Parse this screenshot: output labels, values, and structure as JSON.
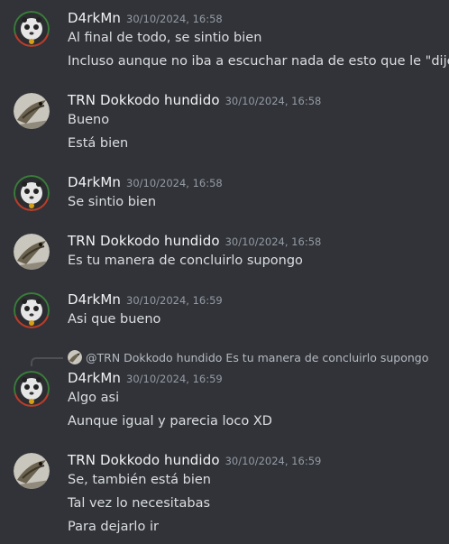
{
  "users": {
    "d4rk": {
      "name": "D4rkMn",
      "avatar_icon": "panda-avatar-icon"
    },
    "trn": {
      "name": "TRN Dokkodo hundido",
      "avatar_icon": "bird-avatar-icon"
    }
  },
  "messages": [
    {
      "user": "D4rkMn",
      "time": "30/10/2024, 16:58",
      "lines": [
        "Al final de todo, se sintio bien",
        "Incluso aunque no iba a escuchar nada de esto que le \"dije\""
      ]
    },
    {
      "user": "TRN Dokkodo hundido",
      "time": "30/10/2024, 16:58",
      "lines": [
        "Bueno",
        "Está bien"
      ]
    },
    {
      "user": "D4rkMn",
      "time": "30/10/2024, 16:58",
      "lines": [
        "Se sintio bien"
      ]
    },
    {
      "user": "TRN Dokkodo hundido",
      "time": "30/10/2024, 16:58",
      "lines": [
        "Es tu manera de concluirlo supongo"
      ]
    },
    {
      "user": "D4rkMn",
      "time": "30/10/2024, 16:59",
      "lines": [
        "Asi que bueno"
      ]
    },
    {
      "user": "D4rkMn",
      "time": "30/10/2024, 16:59",
      "reply": {
        "to": "@TRN Dokkodo hundido",
        "text": "Es tu manera de concluirlo supongo"
      },
      "lines": [
        "Algo asi",
        "Aunque igual y parecia loco XD"
      ]
    },
    {
      "user": "TRN Dokkodo hundido",
      "time": "30/10/2024, 16:59",
      "lines": [
        "Se, también está bien",
        "Tal vez lo necesitabas",
        "Para dejarlo ir"
      ]
    }
  ]
}
